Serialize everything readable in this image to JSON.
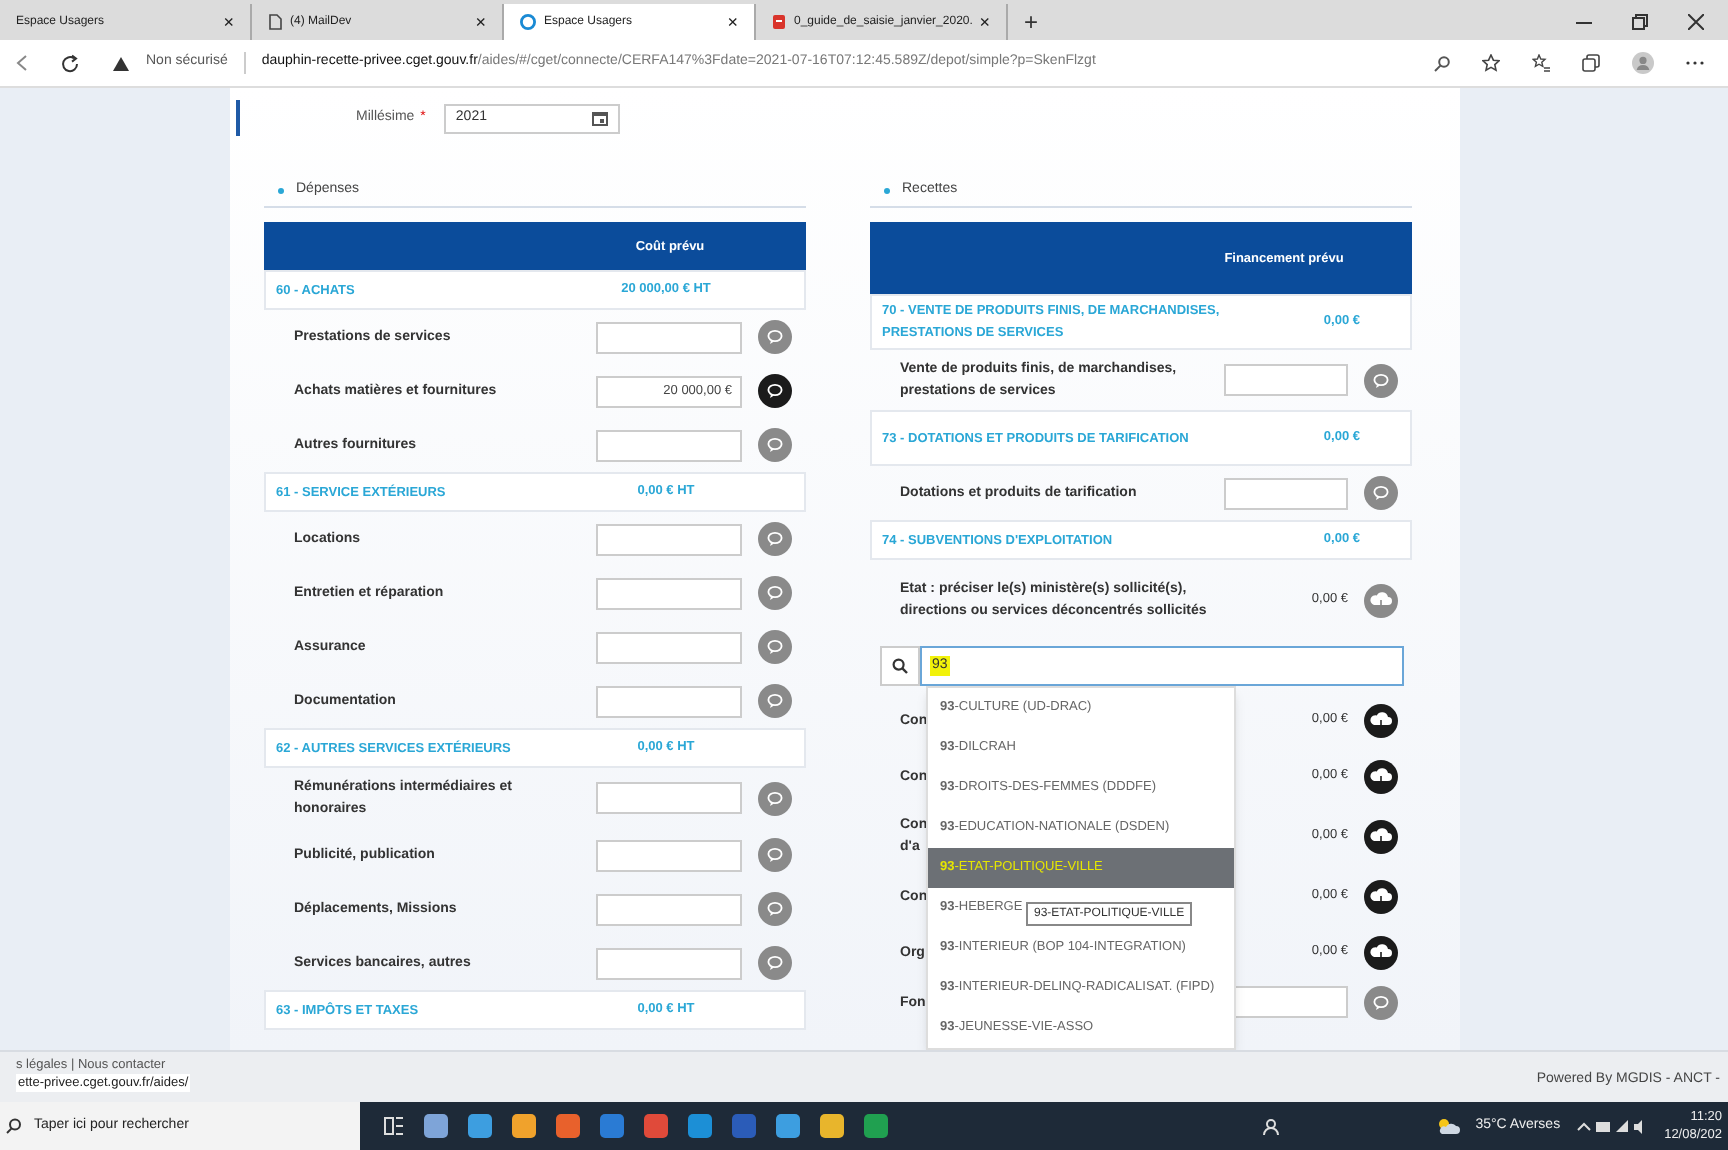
{
  "browser": {
    "tabs": [
      {
        "title": "Espace Usagers",
        "selected": false,
        "close": "×"
      },
      {
        "title": "(4) MailDev",
        "selected": false,
        "kind": "page",
        "close": "×"
      },
      {
        "title": "Espace Usagers",
        "selected": true,
        "kind": "browser",
        "close": "×"
      },
      {
        "title": "0_guide_de_saisie_janvier_2020.",
        "selected": false,
        "kind": "document",
        "close": "×"
      }
    ],
    "new_tab": "+",
    "address": {
      "security": "Non sécurisé",
      "host": "dauphin-recette-privee.cget.gouv.fr",
      "path": "/aides/#/cget/connecte/CERFA147%3Fdate=2021-07-16T07:12:45.589Z/depot/simple?p=SkenFlzgt"
    }
  },
  "millesime": {
    "label": "Millésime",
    "required_mark": "*",
    "value": "2021"
  },
  "depenses": {
    "title": "Dépenses",
    "column": "Coût prévu",
    "sections": [
      {
        "title": "60 - ACHATS",
        "total": "20 000,00 € HT",
        "lines": [
          {
            "kind": "input",
            "label": "Prestations de services",
            "active": false
          },
          {
            "kind": "input",
            "label": "Achats matières et fournitures",
            "value": "20 000,00 €",
            "active": true
          },
          {
            "kind": "input",
            "label": "Autres fournitures",
            "active": false
          }
        ]
      },
      {
        "title": "61 - SERVICE EXTÉRIEURS",
        "total": "0,00 € HT",
        "lines": [
          {
            "kind": "input",
            "label": "Locations",
            "active": false
          },
          {
            "kind": "input",
            "label": "Entretien et réparation",
            "active": false
          },
          {
            "kind": "input",
            "label": "Assurance",
            "active": false
          },
          {
            "kind": "input",
            "label": "Documentation",
            "active": false
          }
        ]
      },
      {
        "title": "62 - AUTRES SERVICES EXTÉRIEURS",
        "total": "0,00 € HT",
        "lines": [
          {
            "kind": "input",
            "label": "Rémunérations intermédiaires et honoraires",
            "active": false
          },
          {
            "kind": "input",
            "label": "Publicité, publication",
            "active": false
          },
          {
            "kind": "input",
            "label": "Déplacements, Missions",
            "active": false
          },
          {
            "kind": "input",
            "label": "Services bancaires, autres",
            "active": false
          }
        ]
      },
      {
        "title": "63 - IMPÔTS ET TAXES",
        "total": "0,00 € HT"
      }
    ]
  },
  "recettes": {
    "title": "Recettes",
    "column": "Financement prévu",
    "sections": [
      {
        "title": "70 - VENTE DE PRODUITS FINIS, DE MARCHANDISES, PRESTATIONS DE SERVICES",
        "total": "0,00 €",
        "lines": [
          {
            "kind": "input",
            "label": "Vente de produits finis, de marchandises, prestations de services",
            "active": false
          }
        ]
      },
      {
        "title": "73 - DOTATIONS ET PRODUITS DE TARIFICATION",
        "total": "0,00 €",
        "lines": [
          {
            "kind": "input",
            "label": "Dotations et produits de tarification",
            "active": false
          }
        ]
      },
      {
        "title": "74 - SUBVENTIONS D'EXPLOITATION",
        "total": "0,00 €",
        "lines": [
          {
            "kind": "amount",
            "label": "Etat : préciser le(s) ministère(s) sollicité(s), directions ou services déconcentrés sollicités",
            "value": "0,00 €",
            "active": false
          },
          {
            "kind": "search",
            "value": "93",
            "options": [
              {
                "label": "**93**-CULTURE (UD-DRAC)",
                "selected": false
              },
              {
                "label": "**93**-DILCRAH",
                "selected": false
              },
              {
                "label": "**93**-DROITS-DES-FEMMES (DDDFE)",
                "selected": false
              },
              {
                "label": "**93**-EDUCATION-NATIONALE (DSDEN)",
                "selected": false
              },
              {
                "label": "**93**-ETAT-POLITIQUE-VILLE",
                "selected": true
              },
              {
                "label": "**93**-HEBERGE",
                "selected": false
              },
              {
                "label": "**93**-INTERIEUR (BOP 104-INTEGRATION)",
                "selected": false
              },
              {
                "label": "**93**-INTERIEUR-DELINQ-RADICALISAT. (FIPD)",
                "selected": false
              },
              {
                "label": "**93**-JEUNESSE-VIE-ASSO",
                "selected": false
              }
            ],
            "tooltip": "93-ETAT-POLITIQUE-VILLE"
          },
          {
            "kind": "amount",
            "label": "Con",
            "value": "0,00 €",
            "active": true
          },
          {
            "kind": "amount",
            "label": "Con",
            "value": "0,00 €",
            "active": true
          },
          {
            "kind": "amount",
            "label": "Con d'a",
            "value": "0,00 €",
            "active": true
          },
          {
            "kind": "amount",
            "label": "Con",
            "value": "0,00 €",
            "active": true
          },
          {
            "kind": "amount",
            "label": "Org",
            "value": "0,00 €",
            "active": true
          },
          {
            "kind": "input",
            "label": "Fon",
            "active": false
          }
        ]
      }
    ]
  },
  "footer": {
    "links": "s légales | Nous contacter",
    "status_url": "ette-privee.cget.gouv.fr/aides/",
    "credit": "Powered By MGDIS - ANCT -"
  },
  "taskbar": {
    "search_placeholder": "Taper ici pour rechercher",
    "weather": "35°C Averses",
    "time": "11:20",
    "date": "12/08/202"
  }
}
